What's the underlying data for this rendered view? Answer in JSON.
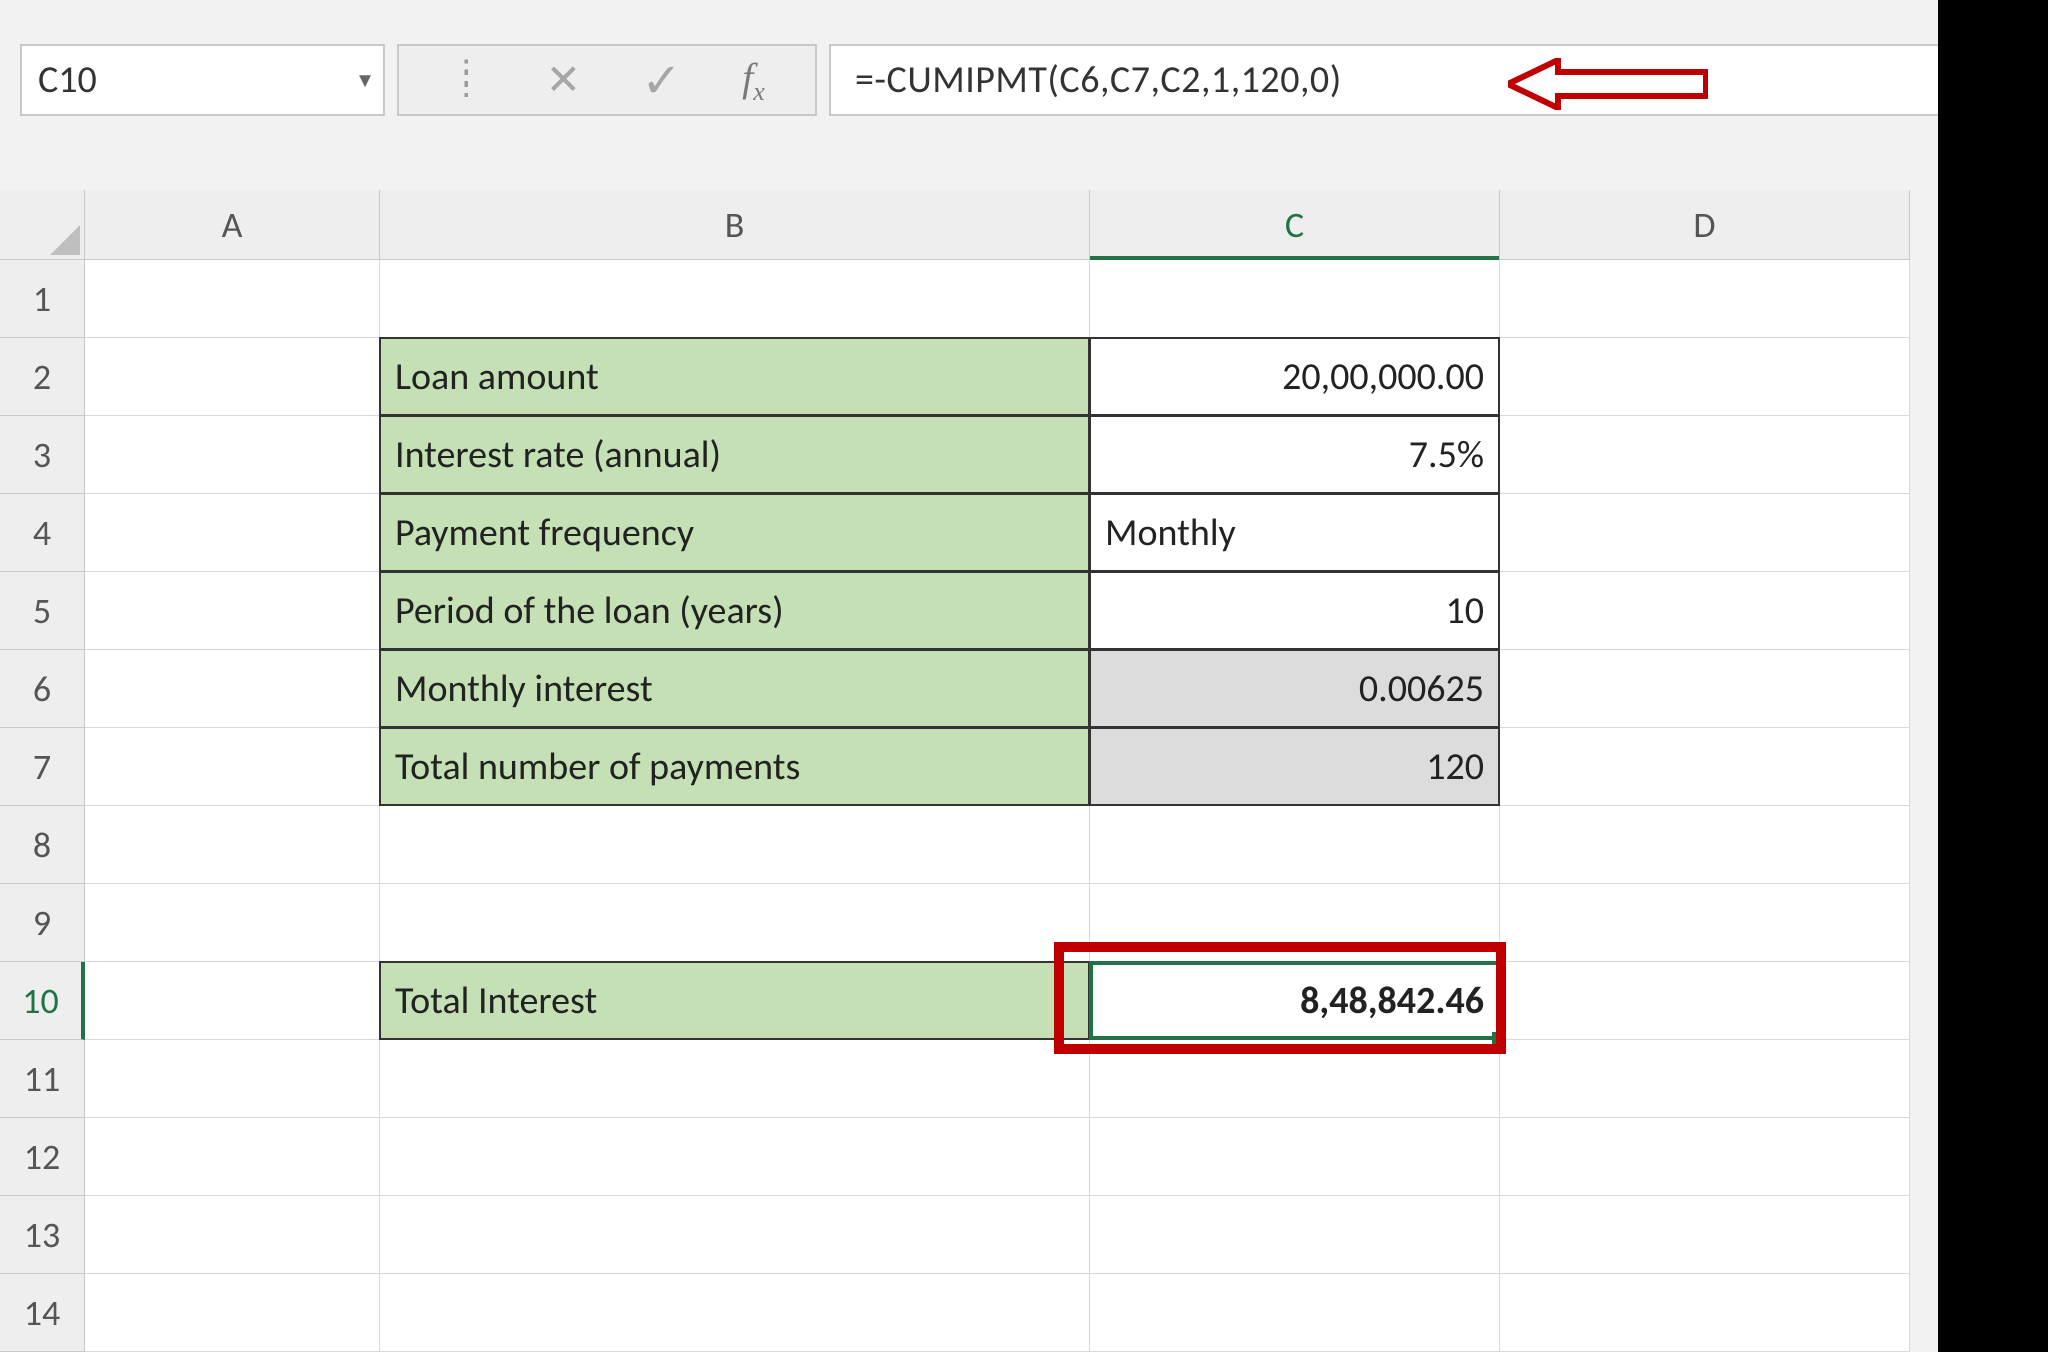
{
  "formula_bar": {
    "cell_ref": "C10",
    "formula": "=-CUMIPMT(C6,C7,C2,1,120,0)"
  },
  "columns": [
    "A",
    "B",
    "C",
    "D"
  ],
  "row_numbers": [
    "1",
    "2",
    "3",
    "4",
    "5",
    "6",
    "7",
    "8",
    "9",
    "10",
    "11",
    "12",
    "13",
    "14"
  ],
  "cells": {
    "b2": "Loan amount",
    "c2": "20,00,000.00",
    "b3": "Interest rate (annual)",
    "c3": "7.5%",
    "b4": "Payment frequency",
    "c4": "Monthly",
    "b5": "Period of the loan (years)",
    "c5": "10",
    "b6": "Monthly interest",
    "c6": "0.00625",
    "b7": "Total number of payments",
    "c7": "120",
    "b10": "Total Interest",
    "c10": "8,48,842.46"
  },
  "selected_cell": "C10"
}
